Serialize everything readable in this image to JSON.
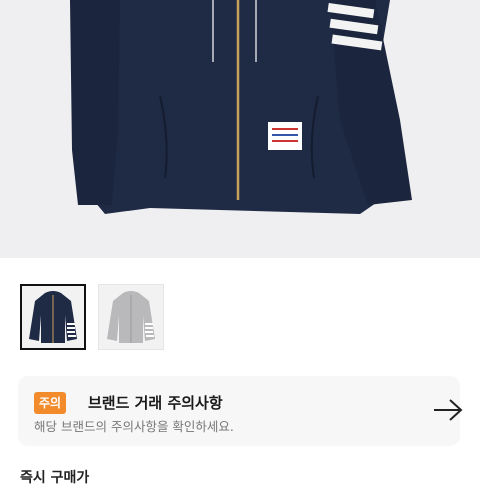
{
  "product_image": {
    "alt": "navy zip-up hoodie",
    "icon": "hoodie-image"
  },
  "thumbnails": [
    {
      "name": "navy",
      "color": "#1f2a44",
      "selected": true
    },
    {
      "name": "gray",
      "color": "#b9b9bb",
      "selected": false
    }
  ],
  "notice": {
    "badge": "주의",
    "title": "브랜드 거래 주의사항",
    "description": "해당 브랜드의 주의사항을 확인하세요.",
    "action_icon": "arrow-right-icon",
    "badge_color": "#f28b2c"
  },
  "section_label": "즉시 구매가"
}
